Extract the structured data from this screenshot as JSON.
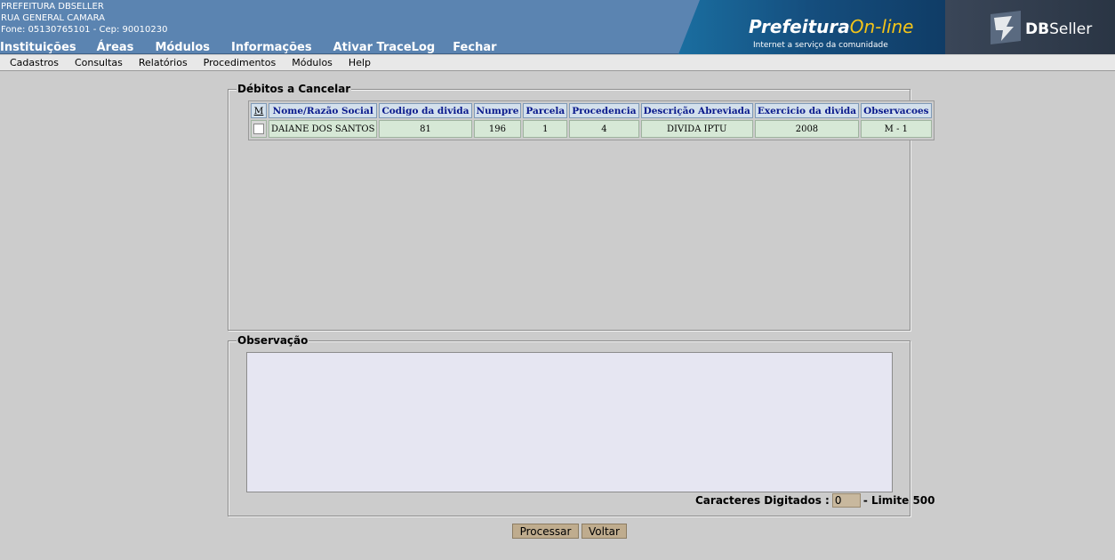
{
  "header": {
    "line1": "PREFEITURA DBSELLER",
    "line2": "RUA GENERAL CAMARA",
    "line3": "Fone: 05130765101  -  Cep: 90010230",
    "menu": [
      "Instituições",
      "Áreas",
      "Módulos",
      "Informações",
      "Ativar TraceLog",
      "Fechar"
    ],
    "banner_title_a": "Prefeitura",
    "banner_title_b": "On-line",
    "banner_subtitle": "Internet a serviço da comunidade",
    "brand_bold": "DB",
    "brand_rest": "Seller"
  },
  "menubar": [
    "Cadastros",
    "Consultas",
    "Relatórios",
    "Procedimentos",
    "Módulos",
    "Help"
  ],
  "debitos": {
    "legend": "Débitos a Cancelar",
    "columns": [
      "M",
      "Nome/Razão Social",
      "Codigo da divida",
      "Numpre",
      "Parcela",
      "Procedencia",
      "Descrição Abreviada",
      "Exercicio da divida",
      "Observacoes"
    ],
    "rows": [
      {
        "nome": "DAIANE DOS SANTOS",
        "codigo": "81",
        "numpre": "196",
        "parcela": "1",
        "procedencia": "4",
        "descricao": "DIVIDA IPTU",
        "exercicio": "2008",
        "obs": "M - 1",
        "checked": false
      }
    ]
  },
  "observacao": {
    "legend": "Observação",
    "text": "",
    "counter_label": "Caracteres Digitados :",
    "counter_value": "0",
    "limit_label": "- Limite 500"
  },
  "buttons": {
    "processar": "Processar",
    "voltar": "Voltar"
  },
  "colors": {
    "header_bg": "#5b84b1",
    "page_bg": "#cccccc",
    "th_bg": "#d3e0ec",
    "td_bg": "#d6e8d6",
    "button_bg": "#bfac8e"
  }
}
